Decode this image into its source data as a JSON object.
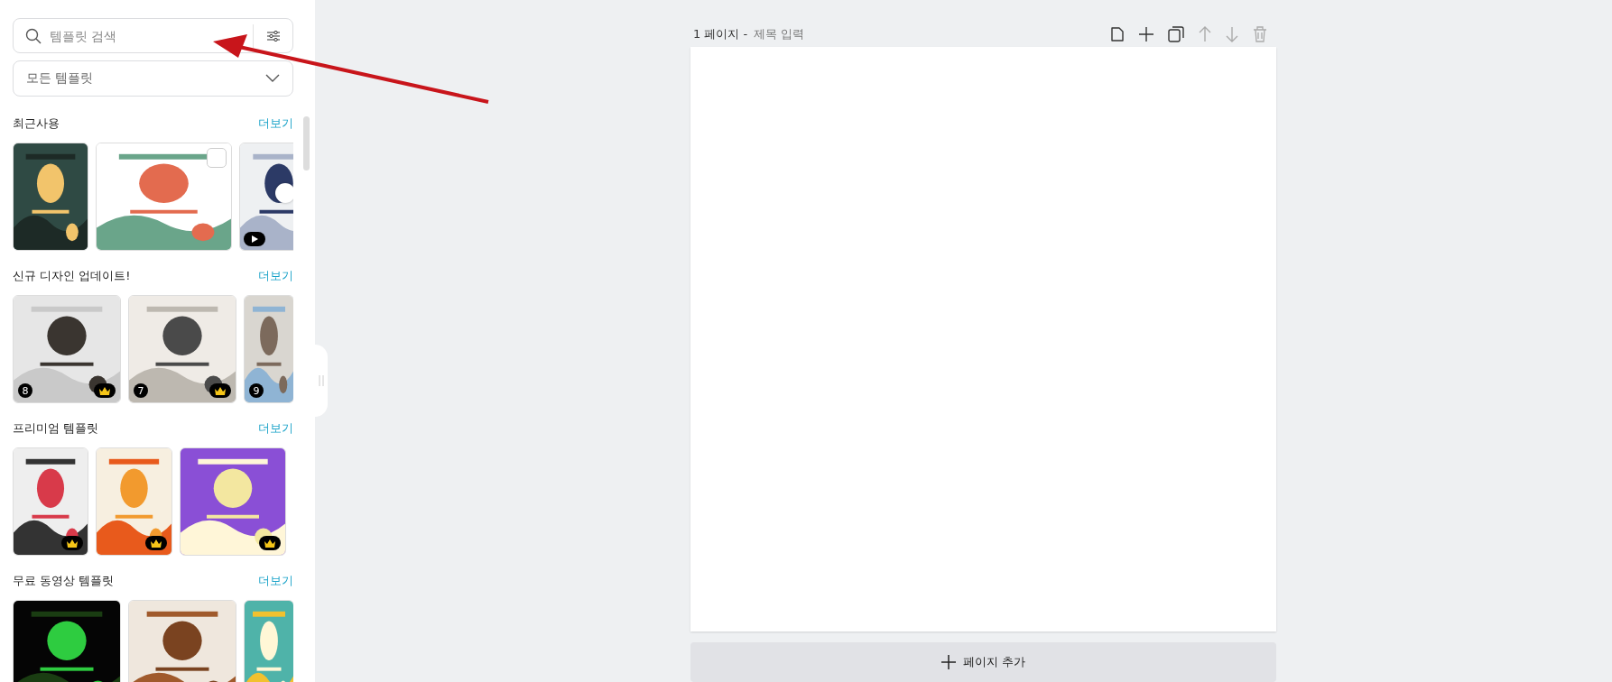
{
  "sidebar": {
    "search": {
      "placeholder": "템플릿 검색"
    },
    "filter": {
      "value": "모든 템플릿"
    },
    "sections": [
      {
        "title": "최근사용",
        "more": "더보기",
        "items": [
          {
            "kind": "picture",
            "premium": false,
            "video": false
          },
          {
            "kind": "picture",
            "premium": false,
            "video": false,
            "checked": false
          },
          {
            "kind": "picture",
            "premium": false,
            "video": true
          }
        ]
      },
      {
        "title": "신규 디자인 업데이트!",
        "more": "더보기",
        "items": [
          {
            "kind": "picture",
            "number": "8",
            "premium": true,
            "video": false
          },
          {
            "kind": "picture",
            "number": "7",
            "premium": true,
            "video": false
          },
          {
            "kind": "picture",
            "number": "9",
            "premium": false,
            "video": false
          }
        ]
      },
      {
        "title": "프리미엄 템플릿",
        "more": "더보기",
        "items": [
          {
            "kind": "picture",
            "premium": true,
            "video": false
          },
          {
            "kind": "picture",
            "premium": true,
            "video": false
          },
          {
            "kind": "picture",
            "premium": true,
            "video": false
          }
        ]
      },
      {
        "title": "무료 동영상 템플릿",
        "more": "더보기",
        "items": [
          {
            "kind": "picture"
          },
          {
            "kind": "picture"
          },
          {
            "kind": "picture"
          }
        ]
      }
    ]
  },
  "page": {
    "number": "1 페이지",
    "separator": "-",
    "title_placeholder": "제목 입력"
  },
  "add_page": "페이지 추가"
}
